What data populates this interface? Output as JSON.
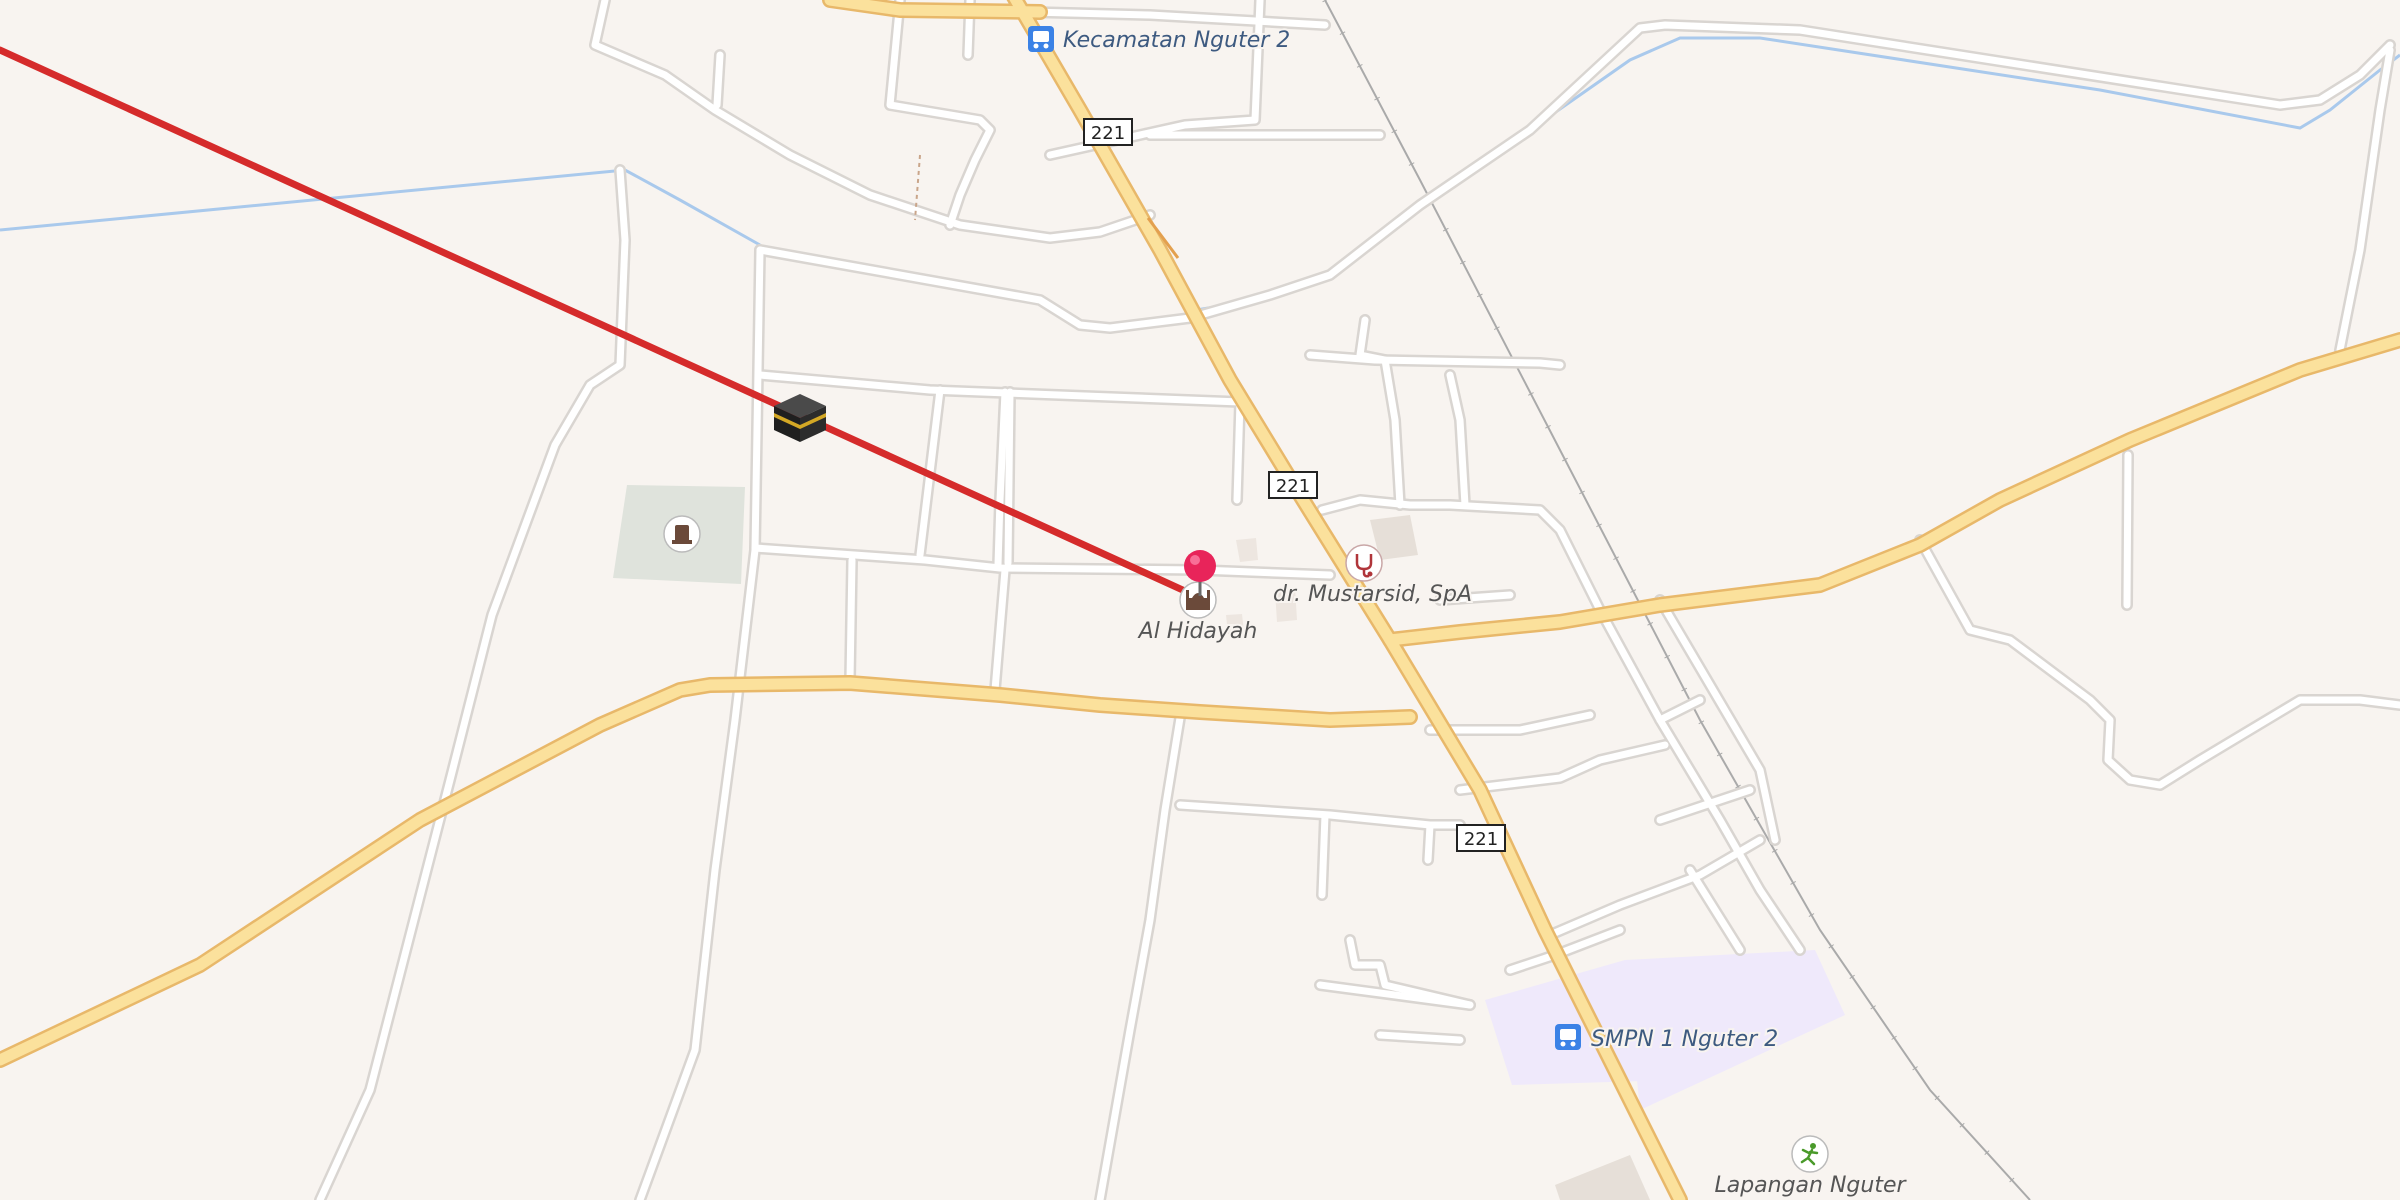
{
  "map": {
    "route_labels": [
      "221",
      "221",
      "221"
    ],
    "places": {
      "bus_stop_1": "Kecamatan Nguter 2",
      "bus_stop_2": "SMPN 1 Nguter 2",
      "mosque": "Al Hidayah",
      "doctor": "dr. Mustarsid, SpA",
      "pitch": "Lapangan Nguter"
    },
    "colors": {
      "background": "#f8f4f0",
      "major_road": "#fbe19c",
      "major_road_casing": "#e8b86a",
      "minor_road": "#ffffff",
      "minor_road_casing": "#d9d5d1",
      "water": "#a9c9ec",
      "qibla_line": "#d52b2b",
      "pin": "#e8245a",
      "school_area": "#efe9fb",
      "cemetery_area": "#dfe3dc",
      "bus_icon": "#3b82e6",
      "label_blue": "#3d5a80",
      "label_gray": "#555555"
    },
    "icons": [
      "kaaba-icon",
      "location-pin-icon",
      "mosque-icon",
      "doctor-icon",
      "bus-stop-icon",
      "cemetery-icon",
      "sports-pitch-icon"
    ]
  }
}
